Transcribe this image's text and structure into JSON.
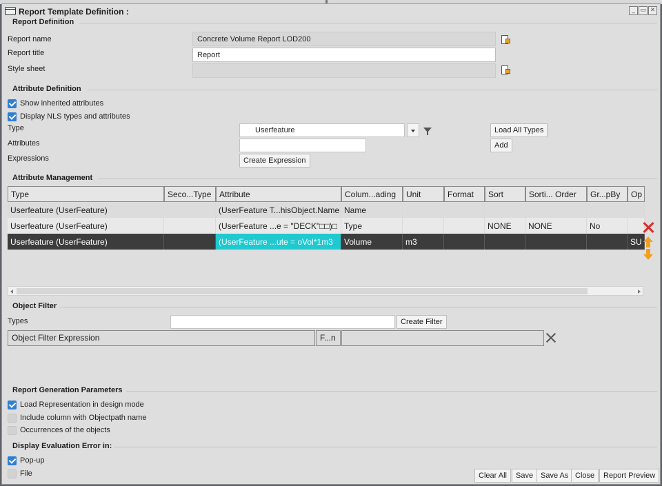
{
  "window": {
    "title": "Report Template Definition :",
    "btn_min": "_",
    "btn_restore": "▭",
    "btn_close": "✕"
  },
  "report_definition": {
    "title": "Report Definition",
    "name_label": "Report name",
    "name_value": "Concrete Volume Report LOD200",
    "title_label": "Report title",
    "title_value": "Report",
    "stylesheet_label": "Style sheet",
    "stylesheet_value": ""
  },
  "attribute_definition": {
    "title": "Attribute Definition",
    "show_inherited": "Show inherited attributes",
    "display_nls": "Display NLS types and attributes",
    "type_label": "Type",
    "type_value": "Userfeature",
    "attributes_label": "Attributes",
    "attributes_value": "",
    "expressions_label": "Expressions",
    "create_expression": "Create Expression",
    "load_all_types": "Load All Types",
    "add": "Add"
  },
  "attribute_management": {
    "title": "Attribute Management",
    "columns": [
      "Type",
      "Seco...Type",
      "Attribute",
      "Colum...ading",
      "Unit",
      "Format",
      "Sort",
      "Sorti... Order",
      "Gr...pBy",
      "Op"
    ],
    "rows": [
      [
        "Userfeature (UserFeature)",
        "",
        "(UserFeature T...hisObject.Name",
        "Name",
        "",
        "",
        "",
        "",
        "",
        ""
      ],
      [
        "Userfeature (UserFeature)",
        "",
        "(UserFeature ...e = \"DECK\"□□)□",
        "Type",
        "",
        "",
        "NONE",
        "NONE",
        "No",
        ""
      ],
      [
        "Userfeature (UserFeature)",
        "",
        "(UserFeature ...ute = oVol*1m3",
        "Volume",
        "m3",
        "",
        "",
        "",
        "",
        "SU"
      ]
    ]
  },
  "object_filter": {
    "title": "Object Filter",
    "types_label": "Types",
    "types_value": "",
    "create_filter": "Create Filter",
    "expression_header": "Object Filter Expression",
    "fn_header": "F...n",
    "value_header": ""
  },
  "report_generation": {
    "title": "Report Generation Parameters",
    "load_representation": "Load Representation in design mode",
    "include_column": "Include column with Objectpath name",
    "occurrences": "Occurrences of the objects"
  },
  "display_error": {
    "title": "Display Evaluation Error in:",
    "popup": "Pop-up",
    "file": "File"
  },
  "footer": {
    "clear_all": "Clear All",
    "save": "Save",
    "save_as": "Save As",
    "close": "Close",
    "report_preview": "Report Preview"
  },
  "colors": {
    "selected_row": "#3c3c3c",
    "highlight_cell": "#20c8cf",
    "checkbox": "#2f7fd2",
    "delete_icon": "#d83030",
    "move_icon": "#f0a020"
  }
}
